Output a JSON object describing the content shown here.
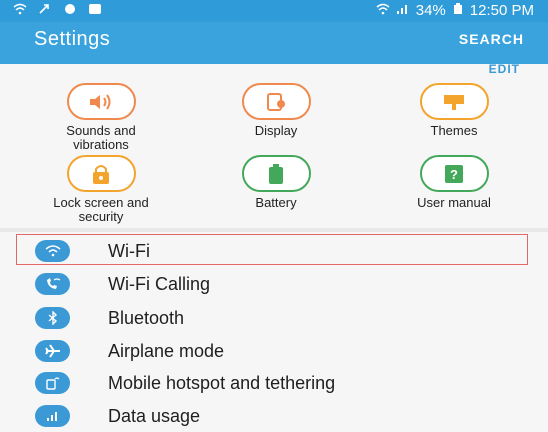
{
  "status_bar": {
    "battery": "34%",
    "time": "12:50 PM"
  },
  "app_bar": {
    "title": "Settings",
    "search_label": "SEARCH"
  },
  "quick_settings": {
    "edit_label": "EDIT",
    "tiles": [
      {
        "label_line1": "Sounds and",
        "label_line2": "vibrations",
        "icon": "speaker-icon",
        "color": "#f0894d"
      },
      {
        "label_line1": "Display",
        "label_line2": "",
        "icon": "display-icon",
        "color": "#f0894d"
      },
      {
        "label_line1": "Themes",
        "label_line2": "",
        "icon": "themes-icon",
        "color": "#f3a42d"
      },
      {
        "label_line1": "Lock screen and",
        "label_line2": "security",
        "icon": "lock-icon",
        "color": "#f3a42d"
      },
      {
        "label_line1": "Battery",
        "label_line2": "",
        "icon": "battery-icon",
        "color": "#43a85a"
      },
      {
        "label_line1": "User manual",
        "label_line2": "",
        "icon": "manual-icon",
        "color": "#43a85a"
      }
    ]
  },
  "list": {
    "items": [
      {
        "label": "Wi-Fi",
        "icon": "wifi-icon"
      },
      {
        "label": "Wi-Fi Calling",
        "icon": "wifi-calling-icon"
      },
      {
        "label": "Bluetooth",
        "icon": "bluetooth-icon"
      },
      {
        "label": "Airplane mode",
        "icon": "airplane-icon"
      },
      {
        "label": "Mobile hotspot and tethering",
        "icon": "hotspot-icon"
      },
      {
        "label": "Data usage",
        "icon": "data-usage-icon"
      }
    ],
    "accent_color": "#3b9ad5",
    "highlight_color": "#e26868"
  }
}
